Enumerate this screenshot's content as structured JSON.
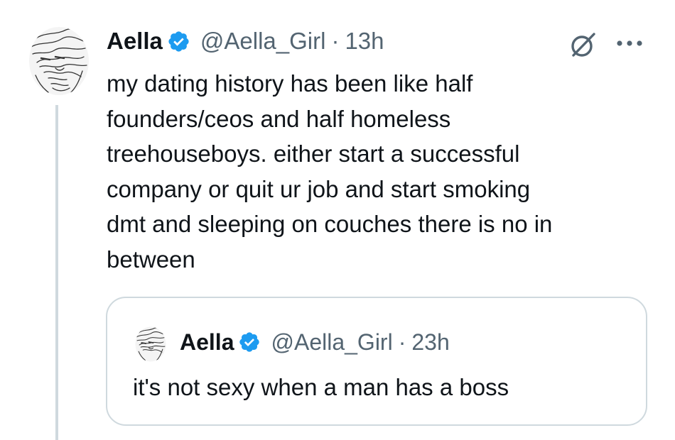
{
  "tweet": {
    "author_name": "Aella",
    "author_handle": "@Aella_Girl",
    "separator": "·",
    "time": "13h",
    "text": "my dating history has been like half\nfounders/ceos and half homeless\ntreehouseboys. either start a successful\ncompany or quit ur job and start smoking\ndmt and sleeping on couches there is no in\nbetween",
    "verified": true,
    "icons": {
      "grok": "grok-icon",
      "more": "more-options-icon",
      "verified": "verified-badge-icon"
    }
  },
  "quoted_tweet": {
    "author_name": "Aella",
    "author_handle": "@Aella_Girl",
    "separator": "·",
    "time": "23h",
    "text": "it's not sexy when a man has a boss",
    "verified": true
  },
  "colors": {
    "text_primary": "#0f1419",
    "text_secondary": "#536471",
    "verified_blue": "#1d9bf0",
    "border": "#cfd9de"
  }
}
